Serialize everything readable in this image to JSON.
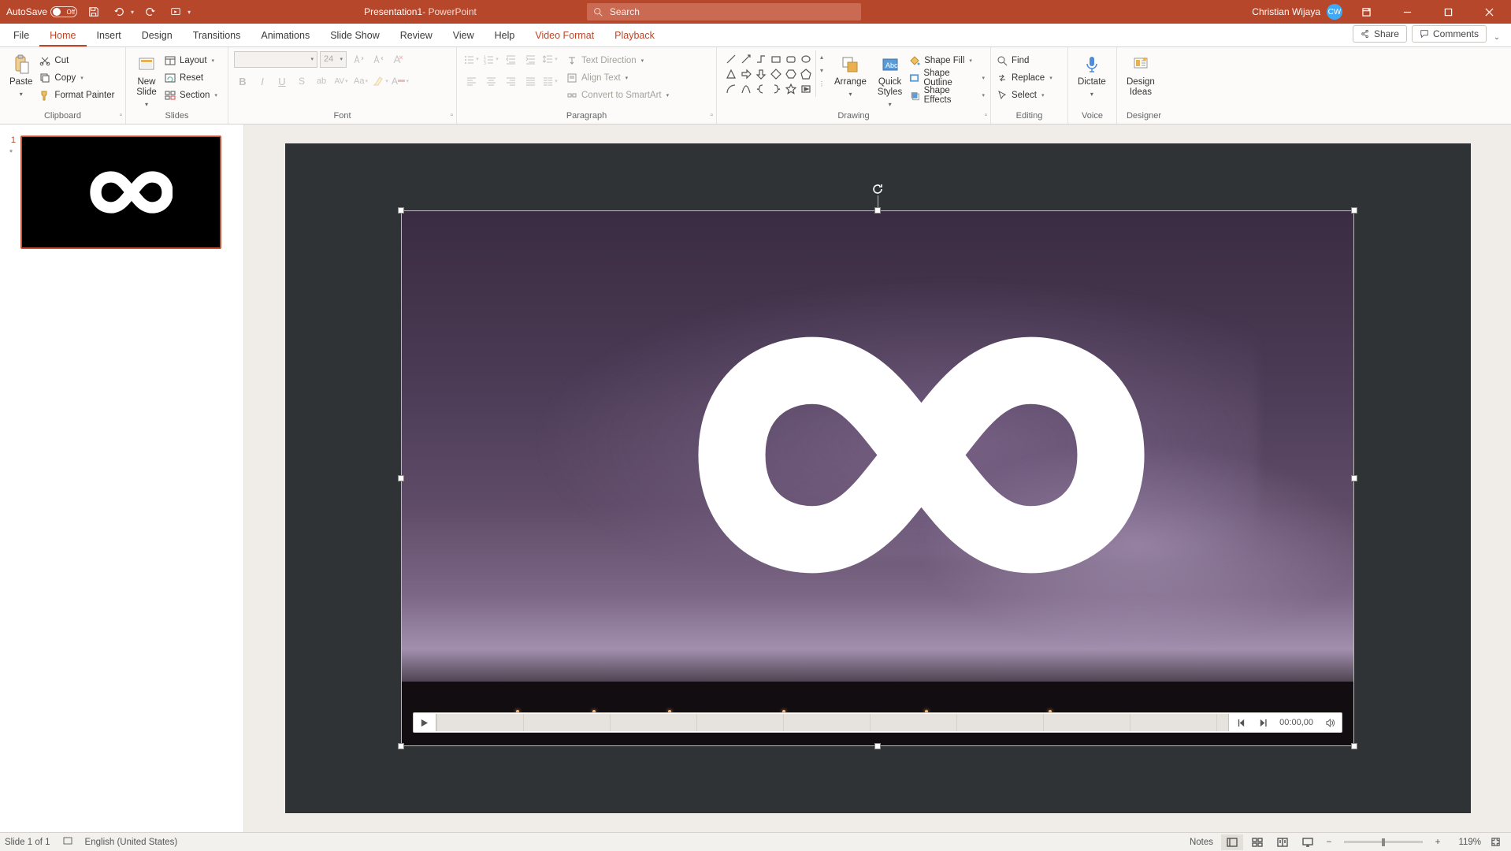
{
  "title_bar": {
    "autosave_label": "AutoSave",
    "autosave_state": "Off",
    "doc_name": "Presentation1",
    "app_name": " - PowerPoint",
    "search_placeholder": "Search",
    "user_name": "Christian Wijaya",
    "user_initials": "CW"
  },
  "tabs": {
    "file": "File",
    "home": "Home",
    "insert": "Insert",
    "design": "Design",
    "transitions": "Transitions",
    "animations": "Animations",
    "slideshow": "Slide Show",
    "review": "Review",
    "view": "View",
    "help": "Help",
    "video_format": "Video Format",
    "playback": "Playback",
    "share": "Share",
    "comments": "Comments"
  },
  "ribbon": {
    "clipboard": {
      "label": "Clipboard",
      "paste": "Paste",
      "cut": "Cut",
      "copy": "Copy",
      "format_painter": "Format Painter"
    },
    "slides": {
      "label": "Slides",
      "new_slide": "New\nSlide",
      "layout": "Layout",
      "reset": "Reset",
      "section": "Section"
    },
    "font": {
      "label": "Font",
      "size": "24"
    },
    "paragraph": {
      "label": "Paragraph",
      "text_direction": "Text Direction",
      "align_text": "Align Text",
      "convert_smartart": "Convert to SmartArt"
    },
    "drawing": {
      "label": "Drawing",
      "arrange": "Arrange",
      "quick_styles": "Quick\nStyles",
      "shape_fill": "Shape Fill",
      "shape_outline": "Shape Outline",
      "shape_effects": "Shape Effects"
    },
    "editing": {
      "label": "Editing",
      "find": "Find",
      "replace": "Replace",
      "select": "Select"
    },
    "voice": {
      "label": "Voice",
      "dictate": "Dictate"
    },
    "designer": {
      "label": "Designer",
      "design_ideas": "Design\nIdeas"
    }
  },
  "thumb": {
    "num": "1",
    "ast": "*"
  },
  "video_controls": {
    "time": "00:00,00"
  },
  "status": {
    "slide_of": "Slide 1 of 1",
    "language": "English (United States)",
    "notes": "Notes",
    "zoom": "119%"
  }
}
